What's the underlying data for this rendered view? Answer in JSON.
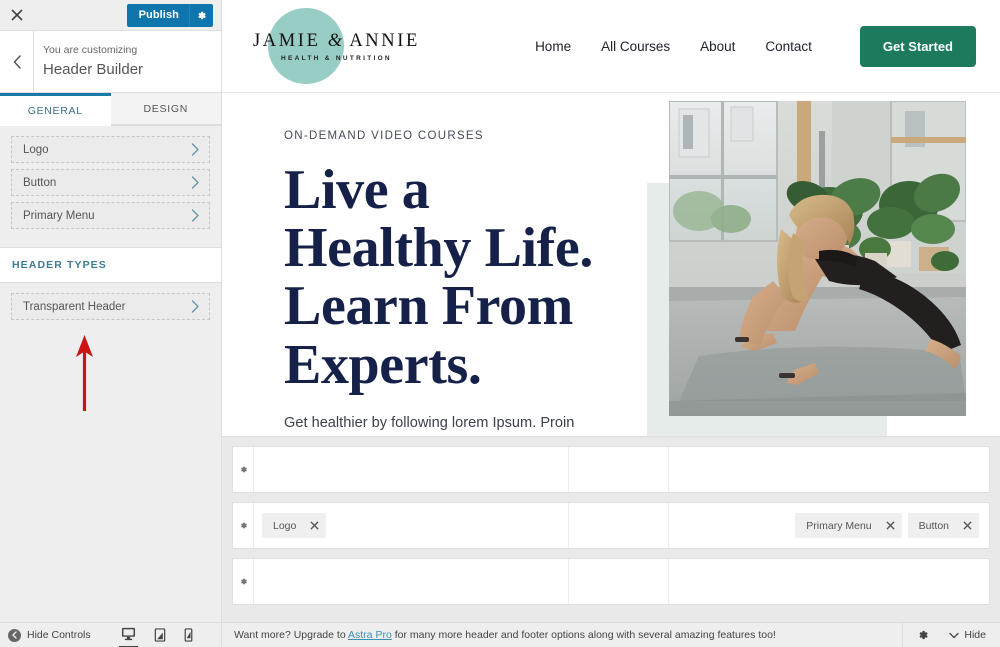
{
  "customizer": {
    "close_icon": "close-icon",
    "publish_label": "Publish",
    "publish_gear_icon": "gear-icon",
    "back_icon": "chevron-left-icon",
    "eyebrow": "You are customizing",
    "title": "Header Builder",
    "tabs": [
      {
        "label": "GENERAL",
        "active": true
      },
      {
        "label": "DESIGN",
        "active": false
      }
    ],
    "items": [
      {
        "label": "Logo"
      },
      {
        "label": "Button"
      },
      {
        "label": "Primary Menu"
      }
    ],
    "section_title": "HEADER TYPES",
    "header_types": [
      {
        "label": "Transparent Header"
      }
    ],
    "chevron_icon": "chevron-right-icon",
    "annotation_arrow": "red-up-arrow"
  },
  "site": {
    "logo": {
      "name_part1": "JAMIE",
      "amp": "&",
      "name_part2": "ANNIE",
      "tagline": "HEALTH & NUTRITION",
      "circle_color": "#8ec9c0"
    },
    "nav": [
      {
        "label": "Home"
      },
      {
        "label": "All Courses"
      },
      {
        "label": "About"
      },
      {
        "label": "Contact"
      }
    ],
    "cta": {
      "label": "Get Started",
      "color": "#1d7a5f"
    },
    "hero": {
      "eyebrow": "ON-DEMAND VIDEO COURSES",
      "title_line1": "Live a",
      "title_line2": "Healthy Life.",
      "title_line3": "Learn From",
      "title_line4": "Experts.",
      "title_color": "#152149",
      "paragraph": "Get healthier by following lorem Ipsum. Proin gravida nibh vel velit auctor aliquet. Aenean sollicitudin, lorem",
      "image_alt": "woman-doing-yoga-lunge-pose"
    }
  },
  "builder": {
    "gear_icon": "gear-icon",
    "rows": [
      {
        "name": "above-header-row",
        "left": [],
        "center": [],
        "right": []
      },
      {
        "name": "primary-header-row",
        "left": [
          {
            "label": "Logo",
            "remove_icon": "close-icon"
          }
        ],
        "center": [],
        "right": [
          {
            "label": "Primary Menu",
            "remove_icon": "close-icon"
          },
          {
            "label": "Button",
            "remove_icon": "close-icon"
          }
        ]
      },
      {
        "name": "below-header-row",
        "left": [],
        "center": [],
        "right": []
      }
    ]
  },
  "footer": {
    "hide_controls_label": "Hide Controls",
    "hide_controls_icon": "collapse-left-icon",
    "devices": [
      {
        "name": "desktop",
        "icon": "desktop-icon",
        "active": true
      },
      {
        "name": "tablet",
        "icon": "tablet-icon",
        "active": false
      },
      {
        "name": "mobile",
        "icon": "mobile-icon",
        "active": false
      }
    ],
    "message_prefix": "Want more? Upgrade to ",
    "message_link": "Astra Pro",
    "message_suffix": " for many more header and footer options along with several amazing features too!",
    "gear_icon": "gear-icon",
    "hide_label": "Hide",
    "hide_icon": "chevron-down-icon"
  }
}
